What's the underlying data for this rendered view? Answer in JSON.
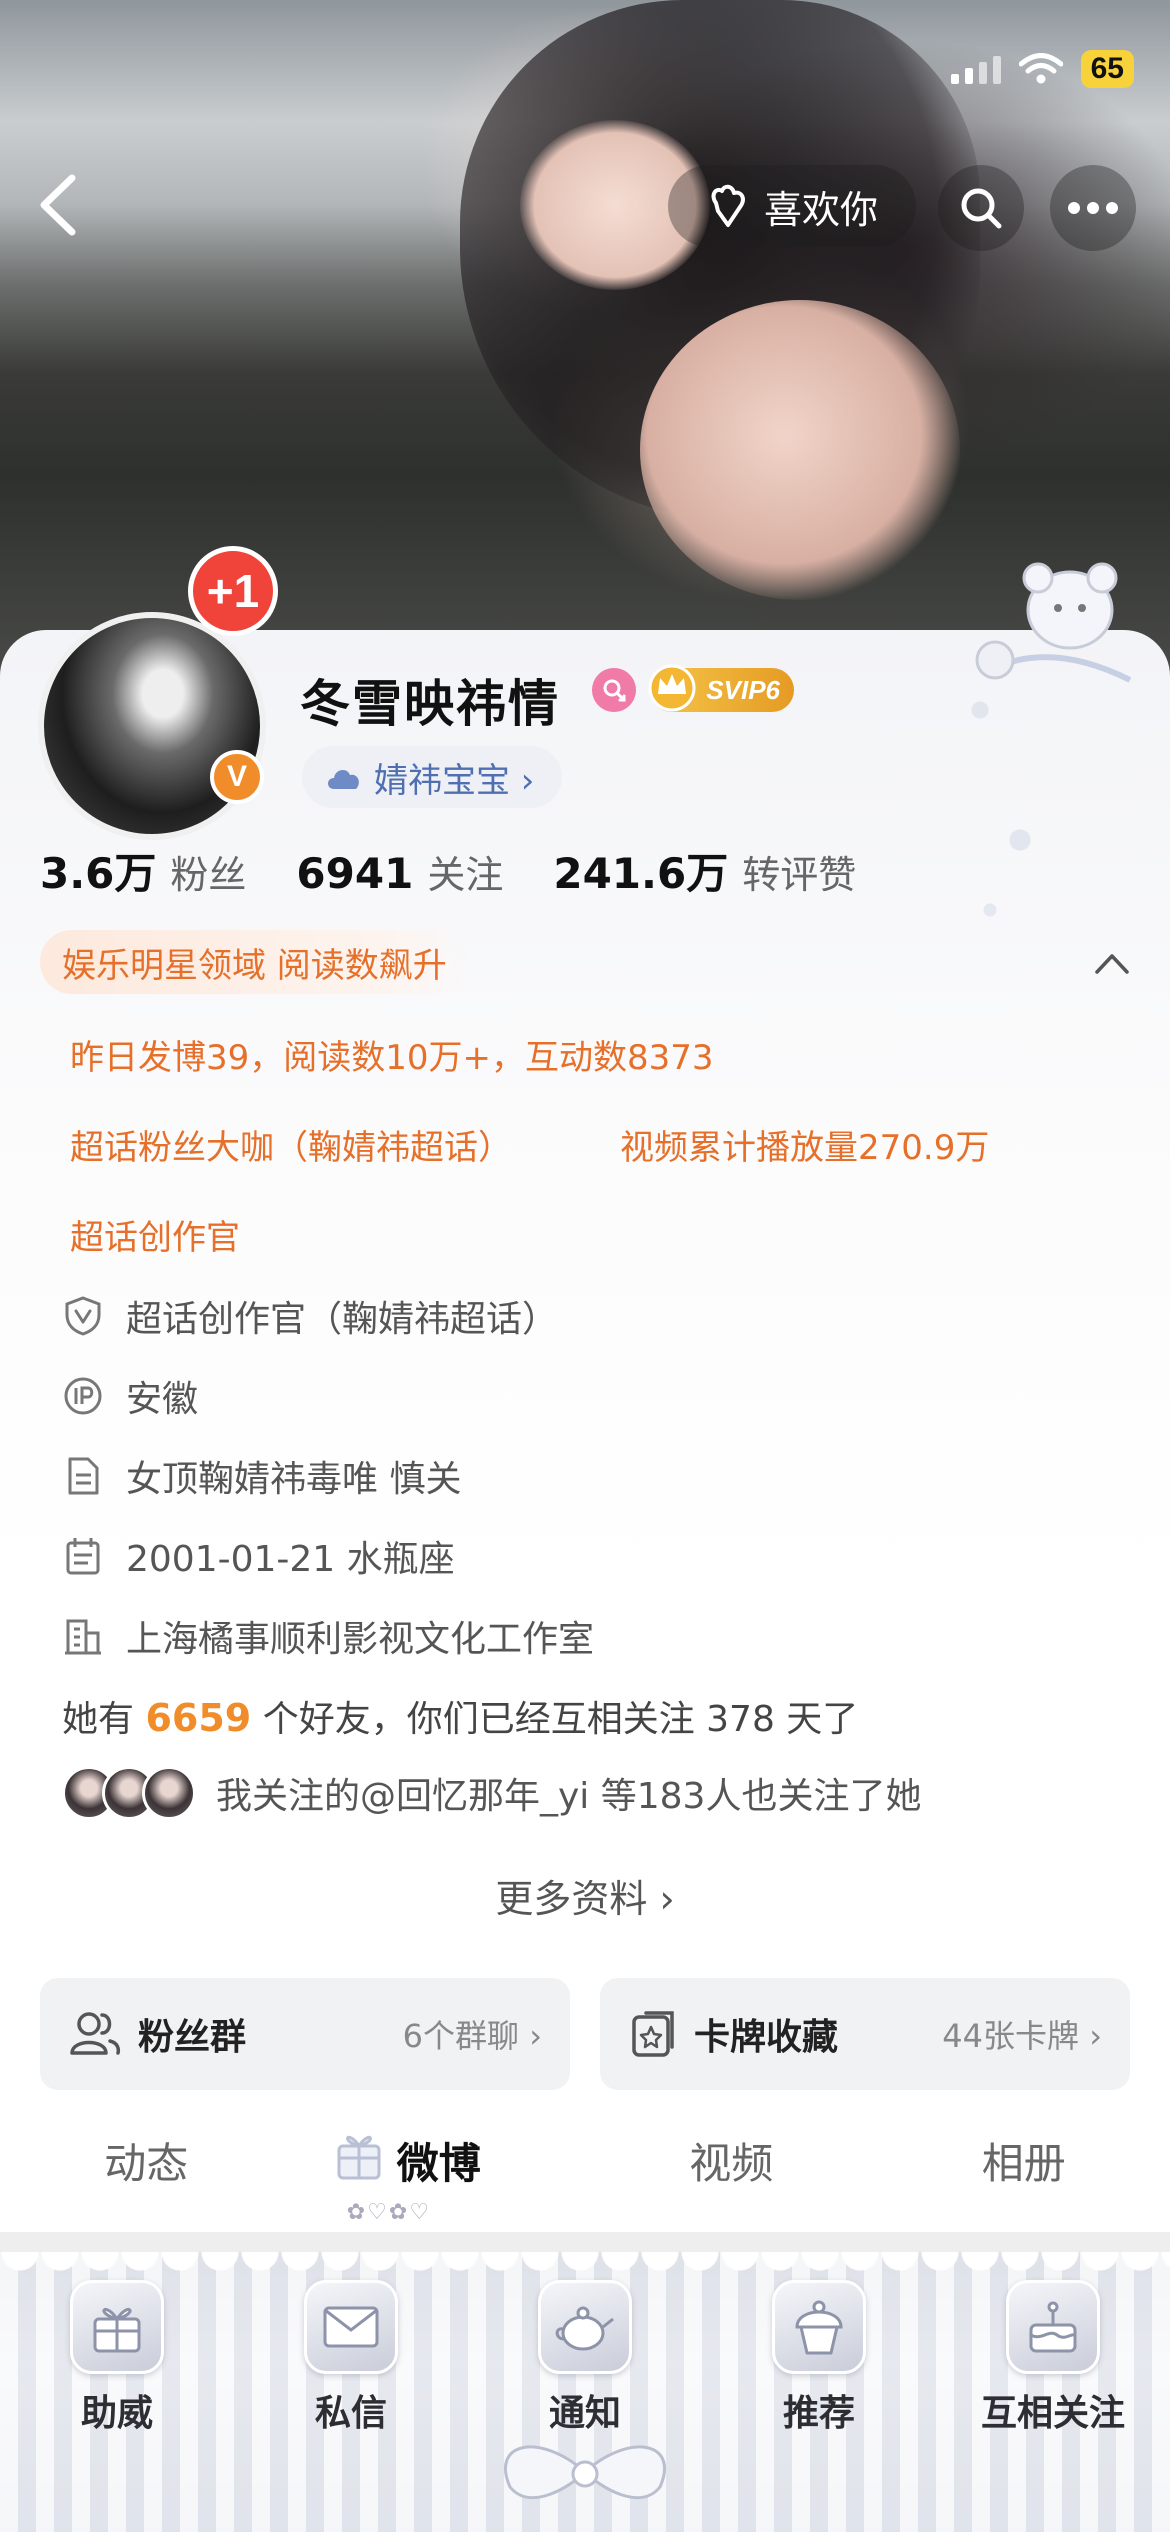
{
  "status_bar": {
    "battery": "65"
  },
  "header": {
    "like_label": "喜欢你"
  },
  "profile": {
    "name": "冬雪映祎情",
    "vip_badge": "SVIP6",
    "avatar_badge": "+1",
    "verified_mark": "V",
    "tag_chip": "婧祎宝宝 ›"
  },
  "stats": [
    {
      "value": "3.6万",
      "label": "粉丝"
    },
    {
      "value": "6941",
      "label": "关注"
    },
    {
      "value": "241.6万",
      "label": "转评赞"
    }
  ],
  "honors": {
    "domain": "娱乐明星领域 阅读数飙升",
    "yesterday": "昨日发博39，阅读数10万+，互动数8373",
    "super_fan": "超话粉丝大咖（鞠婧祎超话）",
    "video_plays": "视频累计播放量270.9万",
    "creator": "超话创作官"
  },
  "info": [
    {
      "icon": "shield-v-icon",
      "text": "超话创作官（鞠婧祎超话）"
    },
    {
      "icon": "ip-icon",
      "text": "安徽"
    },
    {
      "icon": "document-icon",
      "text": "女顶鞠婧祎毒唯 慎关"
    },
    {
      "icon": "calendar-icon",
      "text": "2001-01-21 水瓶座"
    },
    {
      "icon": "building-icon",
      "text": "上海橘事顺利影视文化工作室"
    }
  ],
  "friends": {
    "prefix": "她有",
    "count": "6659",
    "suffix": "个好友，你们已经互相关注 378 天了"
  },
  "mutual_follow": "我关注的@回忆那年_yi  等183人也关注了她",
  "more_info": "更多资料 ›",
  "boxes": [
    {
      "icon": "users-icon",
      "title": "粉丝群",
      "sub": "6个群聊 ›"
    },
    {
      "icon": "card-icon",
      "title": "卡牌收藏",
      "sub": "44张卡牌 ›"
    }
  ],
  "tabs": [
    "动态",
    "微博",
    "视频",
    "相册"
  ],
  "active_tab": "微博",
  "bottom_bar": [
    "助威",
    "私信",
    "通知",
    "推荐",
    "互相关注"
  ],
  "colors": {
    "accent_orange": "#e6702a",
    "link_blue": "#4f6fb0",
    "vip_gold": "#f5c54a",
    "badge_red": "#f0433a"
  }
}
